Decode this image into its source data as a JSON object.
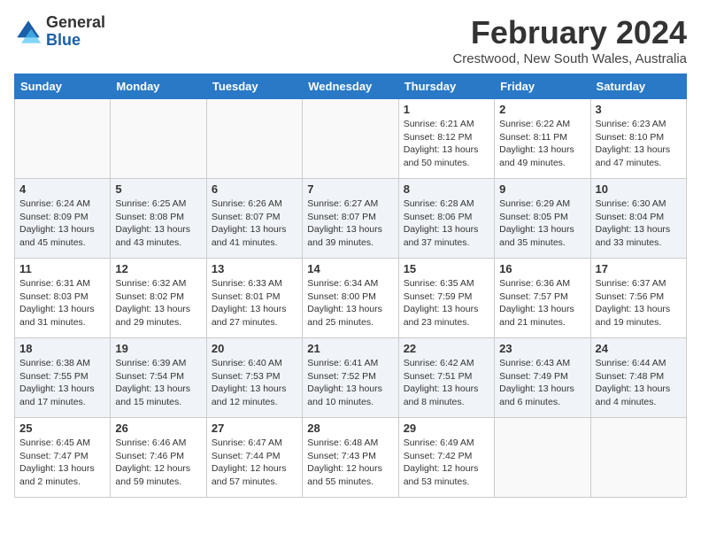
{
  "logo": {
    "general": "General",
    "blue": "Blue"
  },
  "header": {
    "month_year": "February 2024",
    "location": "Crestwood, New South Wales, Australia"
  },
  "days_of_week": [
    "Sunday",
    "Monday",
    "Tuesday",
    "Wednesday",
    "Thursday",
    "Friday",
    "Saturday"
  ],
  "weeks": [
    [
      {
        "day": "",
        "detail": ""
      },
      {
        "day": "",
        "detail": ""
      },
      {
        "day": "",
        "detail": ""
      },
      {
        "day": "",
        "detail": ""
      },
      {
        "day": "1",
        "detail": "Sunrise: 6:21 AM\nSunset: 8:12 PM\nDaylight: 13 hours\nand 50 minutes."
      },
      {
        "day": "2",
        "detail": "Sunrise: 6:22 AM\nSunset: 8:11 PM\nDaylight: 13 hours\nand 49 minutes."
      },
      {
        "day": "3",
        "detail": "Sunrise: 6:23 AM\nSunset: 8:10 PM\nDaylight: 13 hours\nand 47 minutes."
      }
    ],
    [
      {
        "day": "4",
        "detail": "Sunrise: 6:24 AM\nSunset: 8:09 PM\nDaylight: 13 hours\nand 45 minutes."
      },
      {
        "day": "5",
        "detail": "Sunrise: 6:25 AM\nSunset: 8:08 PM\nDaylight: 13 hours\nand 43 minutes."
      },
      {
        "day": "6",
        "detail": "Sunrise: 6:26 AM\nSunset: 8:07 PM\nDaylight: 13 hours\nand 41 minutes."
      },
      {
        "day": "7",
        "detail": "Sunrise: 6:27 AM\nSunset: 8:07 PM\nDaylight: 13 hours\nand 39 minutes."
      },
      {
        "day": "8",
        "detail": "Sunrise: 6:28 AM\nSunset: 8:06 PM\nDaylight: 13 hours\nand 37 minutes."
      },
      {
        "day": "9",
        "detail": "Sunrise: 6:29 AM\nSunset: 8:05 PM\nDaylight: 13 hours\nand 35 minutes."
      },
      {
        "day": "10",
        "detail": "Sunrise: 6:30 AM\nSunset: 8:04 PM\nDaylight: 13 hours\nand 33 minutes."
      }
    ],
    [
      {
        "day": "11",
        "detail": "Sunrise: 6:31 AM\nSunset: 8:03 PM\nDaylight: 13 hours\nand 31 minutes."
      },
      {
        "day": "12",
        "detail": "Sunrise: 6:32 AM\nSunset: 8:02 PM\nDaylight: 13 hours\nand 29 minutes."
      },
      {
        "day": "13",
        "detail": "Sunrise: 6:33 AM\nSunset: 8:01 PM\nDaylight: 13 hours\nand 27 minutes."
      },
      {
        "day": "14",
        "detail": "Sunrise: 6:34 AM\nSunset: 8:00 PM\nDaylight: 13 hours\nand 25 minutes."
      },
      {
        "day": "15",
        "detail": "Sunrise: 6:35 AM\nSunset: 7:59 PM\nDaylight: 13 hours\nand 23 minutes."
      },
      {
        "day": "16",
        "detail": "Sunrise: 6:36 AM\nSunset: 7:57 PM\nDaylight: 13 hours\nand 21 minutes."
      },
      {
        "day": "17",
        "detail": "Sunrise: 6:37 AM\nSunset: 7:56 PM\nDaylight: 13 hours\nand 19 minutes."
      }
    ],
    [
      {
        "day": "18",
        "detail": "Sunrise: 6:38 AM\nSunset: 7:55 PM\nDaylight: 13 hours\nand 17 minutes."
      },
      {
        "day": "19",
        "detail": "Sunrise: 6:39 AM\nSunset: 7:54 PM\nDaylight: 13 hours\nand 15 minutes."
      },
      {
        "day": "20",
        "detail": "Sunrise: 6:40 AM\nSunset: 7:53 PM\nDaylight: 13 hours\nand 12 minutes."
      },
      {
        "day": "21",
        "detail": "Sunrise: 6:41 AM\nSunset: 7:52 PM\nDaylight: 13 hours\nand 10 minutes."
      },
      {
        "day": "22",
        "detail": "Sunrise: 6:42 AM\nSunset: 7:51 PM\nDaylight: 13 hours\nand 8 minutes."
      },
      {
        "day": "23",
        "detail": "Sunrise: 6:43 AM\nSunset: 7:49 PM\nDaylight: 13 hours\nand 6 minutes."
      },
      {
        "day": "24",
        "detail": "Sunrise: 6:44 AM\nSunset: 7:48 PM\nDaylight: 13 hours\nand 4 minutes."
      }
    ],
    [
      {
        "day": "25",
        "detail": "Sunrise: 6:45 AM\nSunset: 7:47 PM\nDaylight: 13 hours\nand 2 minutes."
      },
      {
        "day": "26",
        "detail": "Sunrise: 6:46 AM\nSunset: 7:46 PM\nDaylight: 12 hours\nand 59 minutes."
      },
      {
        "day": "27",
        "detail": "Sunrise: 6:47 AM\nSunset: 7:44 PM\nDaylight: 12 hours\nand 57 minutes."
      },
      {
        "day": "28",
        "detail": "Sunrise: 6:48 AM\nSunset: 7:43 PM\nDaylight: 12 hours\nand 55 minutes."
      },
      {
        "day": "29",
        "detail": "Sunrise: 6:49 AM\nSunset: 7:42 PM\nDaylight: 12 hours\nand 53 minutes."
      },
      {
        "day": "",
        "detail": ""
      },
      {
        "day": "",
        "detail": ""
      }
    ]
  ]
}
